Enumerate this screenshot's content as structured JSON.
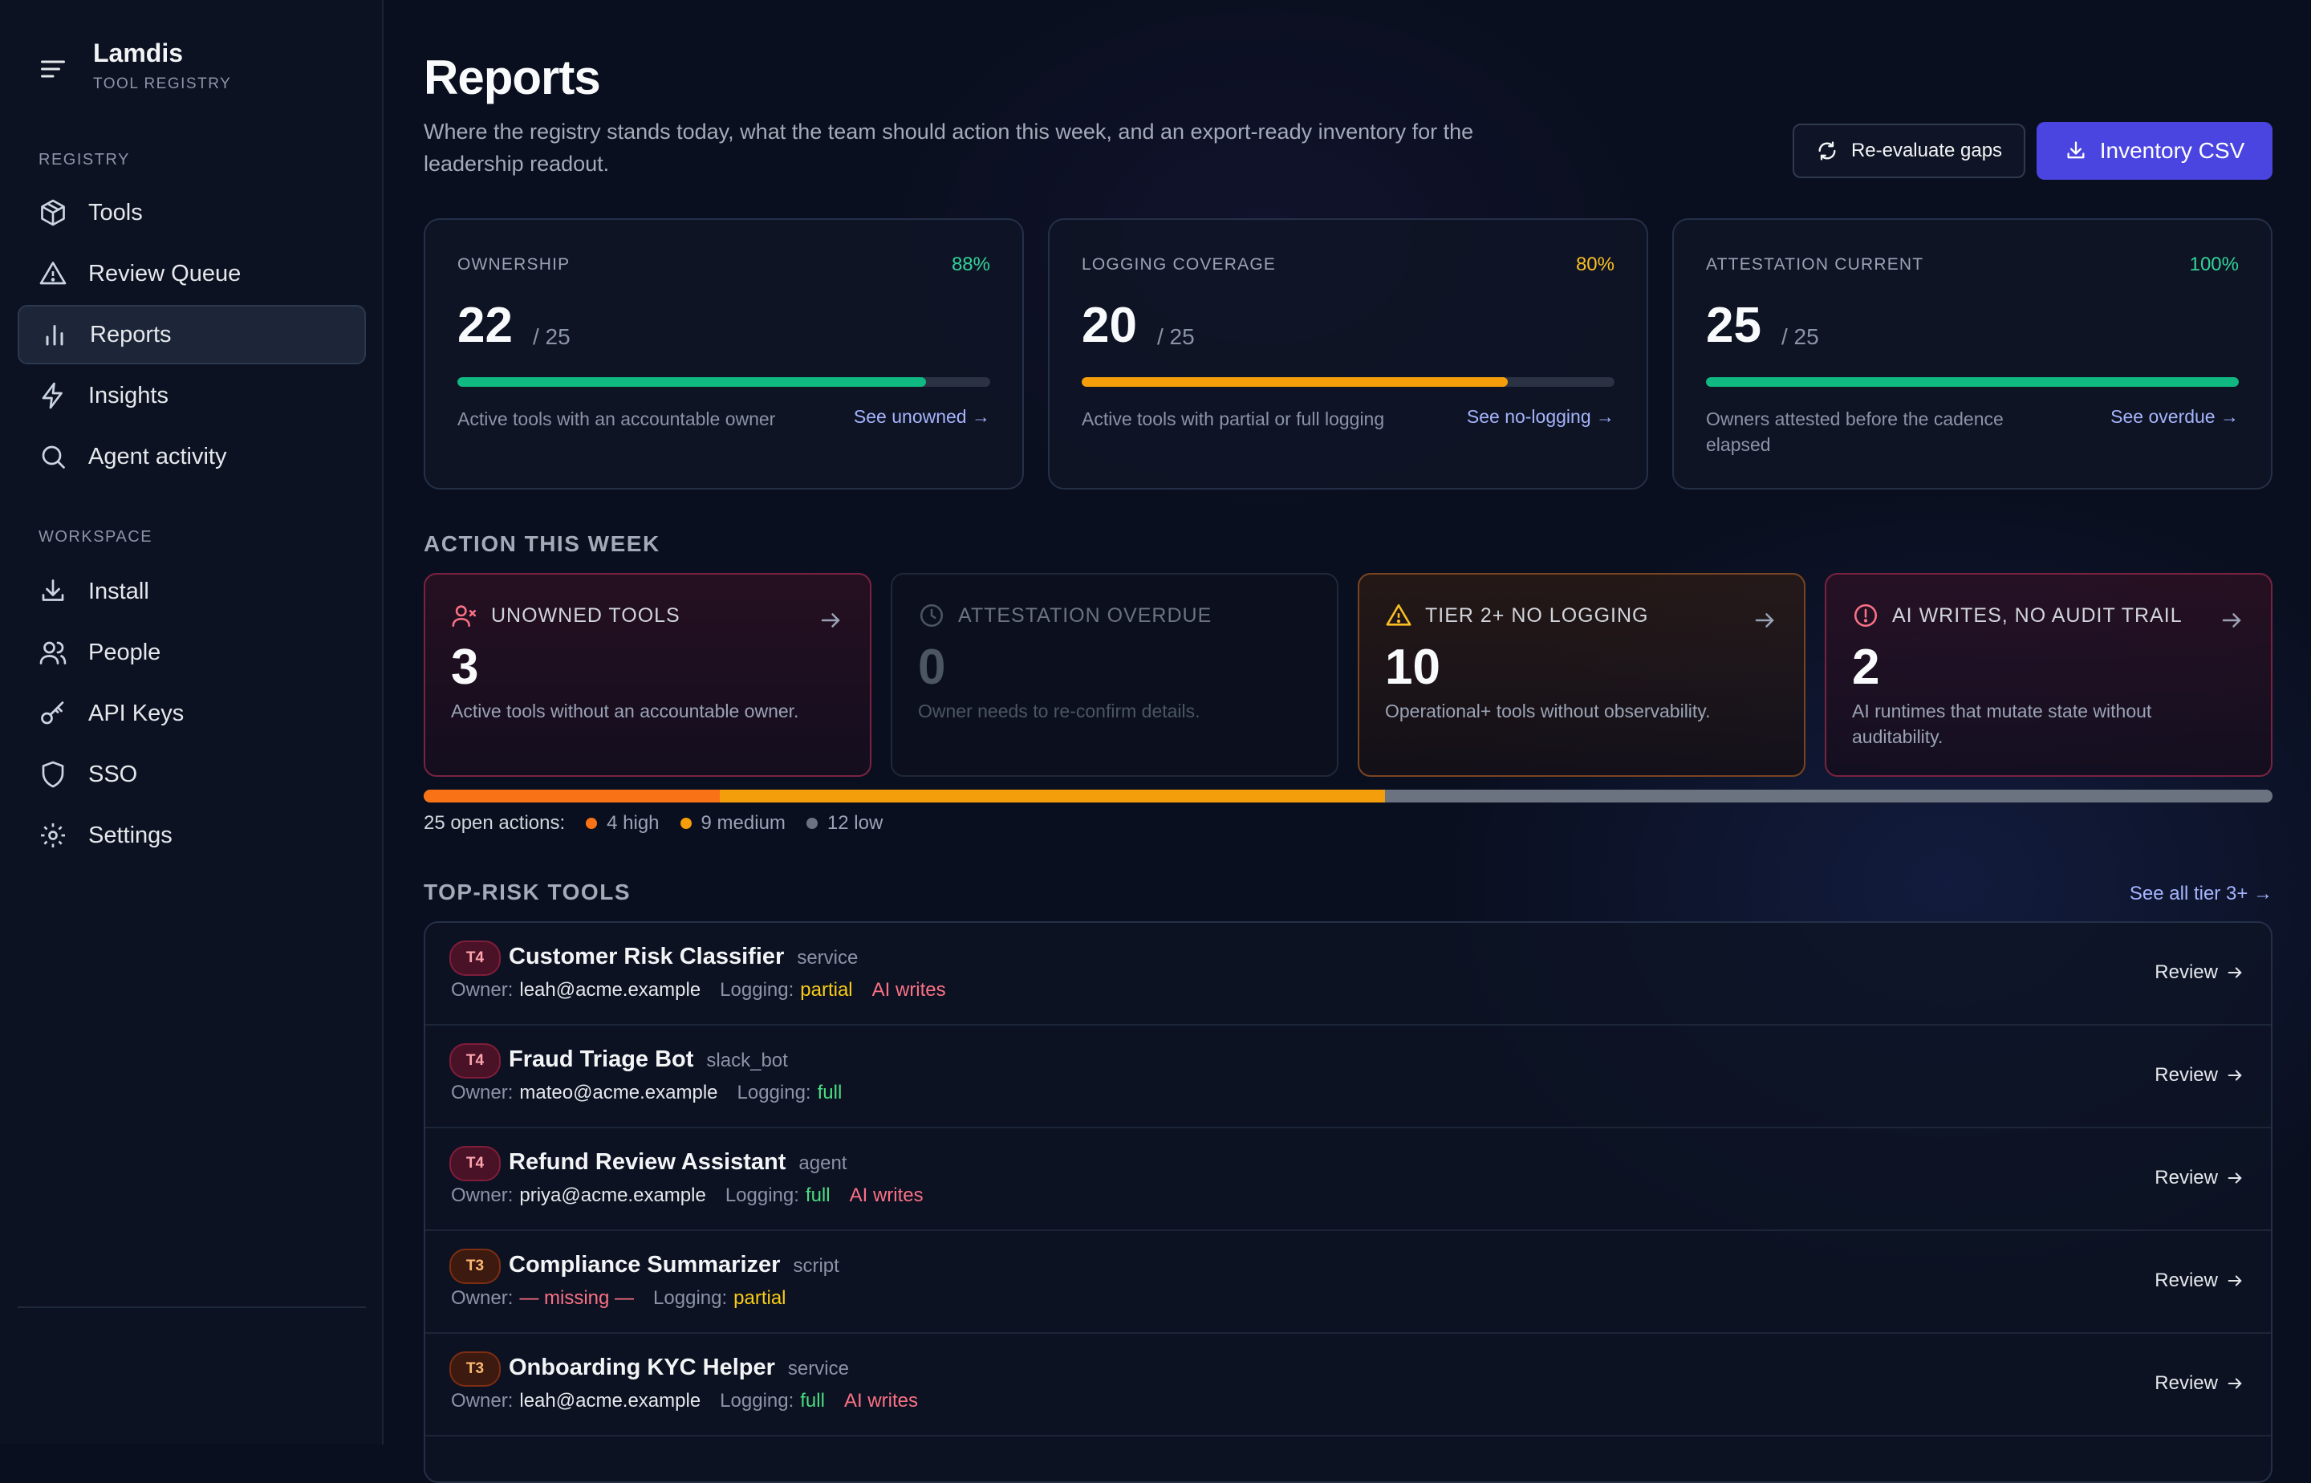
{
  "brand": {
    "title": "Lamdis",
    "subtitle": "TOOL REGISTRY"
  },
  "nav": {
    "registry_label": "REGISTRY",
    "workspace_label": "WORKSPACE",
    "registry_items": [
      {
        "label": "Tools",
        "icon": "box-icon"
      },
      {
        "label": "Review Queue",
        "icon": "warning-icon"
      },
      {
        "label": "Reports",
        "icon": "bar-chart-icon",
        "active": true
      },
      {
        "label": "Insights",
        "icon": "lightning-icon"
      },
      {
        "label": "Agent activity",
        "icon": "search-icon"
      }
    ],
    "workspace_items": [
      {
        "label": "Install",
        "icon": "download-icon"
      },
      {
        "label": "People",
        "icon": "people-icon"
      },
      {
        "label": "API Keys",
        "icon": "key-icon"
      },
      {
        "label": "SSO",
        "icon": "shield-icon"
      },
      {
        "label": "Settings",
        "icon": "gear-icon"
      }
    ]
  },
  "header": {
    "title": "Reports",
    "description": "Where the registry stands today, what the team should action this week, and an export-ready inventory for the leadership readout.",
    "reevaluate_label": "Re-evaluate gaps",
    "export_label": "Inventory CSV"
  },
  "metrics": [
    {
      "label": "OWNERSHIP",
      "pct": "88%",
      "pct_value": 0.88,
      "value": "22",
      "total": "/ 25",
      "desc": "Active tools with an accountable owner",
      "link": "See unowned →",
      "color": "#10b981",
      "pct_color": "#34d399"
    },
    {
      "label": "LOGGING COVERAGE",
      "pct": "80%",
      "pct_value": 0.8,
      "value": "20",
      "total": "/ 25",
      "desc": "Active tools with partial or full logging",
      "link": "See no-logging →",
      "color": "#f59e0b",
      "pct_color": "#fbbf24"
    },
    {
      "label": "ATTESTATION CURRENT",
      "pct": "100%",
      "pct_value": 1.0,
      "value": "25",
      "total": "/ 25",
      "desc": "Owners attested before the cadence elapsed",
      "link": "See overdue →",
      "color": "#10b981",
      "pct_color": "#34d399"
    }
  ],
  "action_section": {
    "title": "ACTION THIS WEEK"
  },
  "actions": [
    {
      "label": "UNOWNED TOOLS",
      "value": "3",
      "desc": "Active tools without an accountable owner.",
      "icon": "user-x-icon",
      "tone": "red"
    },
    {
      "label": "ATTESTATION OVERDUE",
      "value": "0",
      "desc": "Owner needs to re-confirm details.",
      "icon": "clock-icon",
      "tone": "muted"
    },
    {
      "label": "TIER 2+ NO LOGGING",
      "value": "10",
      "desc": "Operational+ tools without observability.",
      "icon": "warning-icon",
      "tone": "amber"
    },
    {
      "label": "AI WRITES, NO AUDIT TRAIL",
      "value": "2",
      "desc": "AI runtimes that mutate state without auditability.",
      "icon": "alert-circle-icon",
      "tone": "red"
    }
  ],
  "open_actions": {
    "label": "25 open actions:",
    "high": {
      "label": "4 high",
      "count": 4,
      "color": "#f97316"
    },
    "medium": {
      "label": "9 medium",
      "count": 9,
      "color": "#f59e0b"
    },
    "low": {
      "label": "12 low",
      "count": 12,
      "color": "#6b7280"
    }
  },
  "risk_section": {
    "title": "TOP-RISK TOOLS",
    "see_all": "See all tier 3+ →"
  },
  "owner_label": "Owner:",
  "logging_label": "Logging:",
  "review_label": "Review",
  "risk_tools": [
    {
      "tier": "T4",
      "name": "Customer Risk Classifier",
      "type": "service",
      "owner": "leah@acme.example",
      "logging": "partial",
      "ai_writes": "AI writes"
    },
    {
      "tier": "T4",
      "name": "Fraud Triage Bot",
      "type": "slack_bot",
      "owner": "mateo@acme.example",
      "logging": "full",
      "ai_writes": ""
    },
    {
      "tier": "T4",
      "name": "Refund Review Assistant",
      "type": "agent",
      "owner": "priya@acme.example",
      "logging": "full",
      "ai_writes": "AI writes"
    },
    {
      "tier": "T3",
      "name": "Compliance Summarizer",
      "type": "script",
      "owner": "— missing —",
      "owner_missing": true,
      "logging": "partial",
      "ai_writes": ""
    },
    {
      "tier": "T3",
      "name": "Onboarding KYC Helper",
      "type": "service",
      "owner": "leah@acme.example",
      "logging": "full",
      "ai_writes": "AI writes"
    }
  ]
}
